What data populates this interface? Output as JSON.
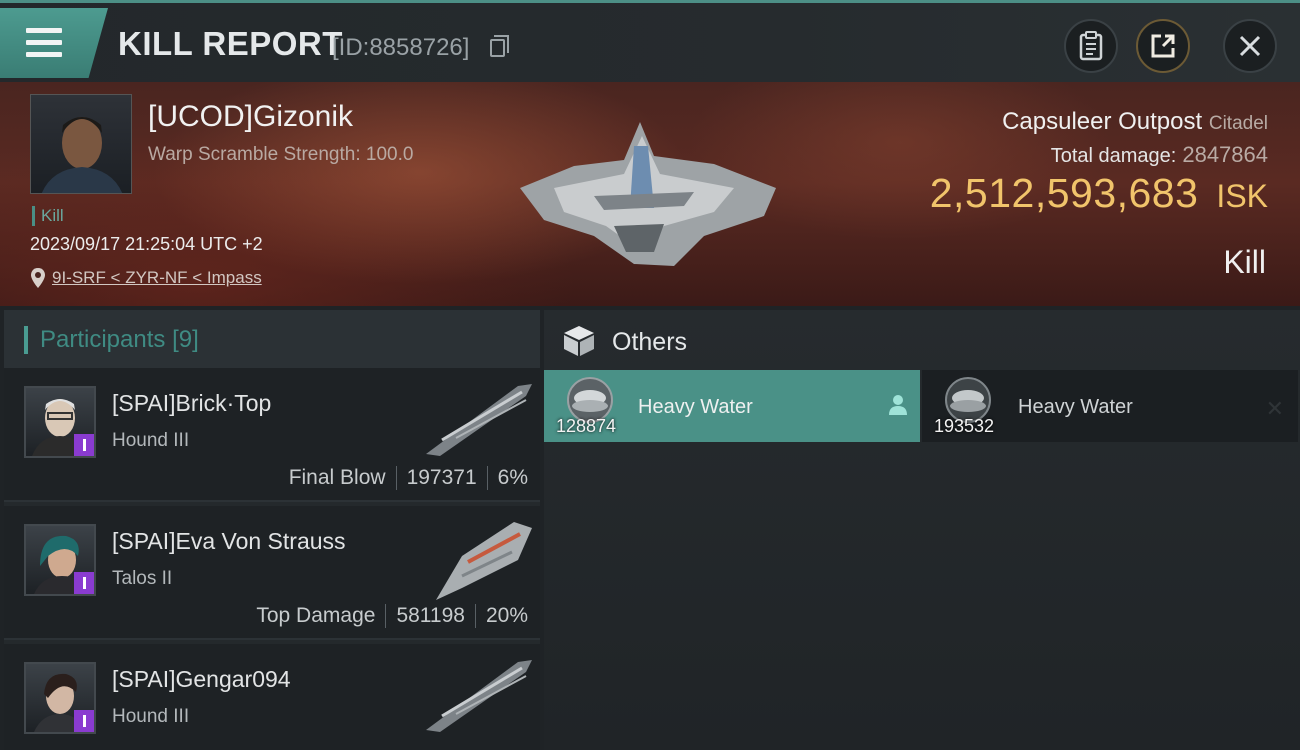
{
  "header": {
    "title": "KILL REPORT",
    "report_id": "[ID:8858726]"
  },
  "victim": {
    "name": "[UCOD]Gizonik",
    "subtitle": "Warp Scramble Strength: 100.0",
    "tag": "Kill",
    "time": "2023/09/17 21:25:04 UTC +2",
    "location": "9I-SRF < ZYR-NF < Impass",
    "target_type": "Capsuleer Outpost",
    "target_class": "Citadel",
    "total_damage_label": "Total damage:",
    "total_damage": "2847864",
    "isk_value": "2,512,593,683",
    "isk_unit": "ISK",
    "result": "Kill"
  },
  "participants": {
    "title": "Participants",
    "count": "[9]",
    "rows": [
      {
        "name": "[SPAI]Brick·Top",
        "ship": "Hound III",
        "role": "Final Blow",
        "damage": "197371",
        "percent": "6%"
      },
      {
        "name": "[SPAI]Eva Von Strauss",
        "ship": "Talos II",
        "role": "Top Damage",
        "damage": "581198",
        "percent": "20%"
      },
      {
        "name": "[SPAI]Gengar094",
        "ship": "Hound III",
        "role": "",
        "damage": "",
        "percent": ""
      }
    ]
  },
  "others": {
    "title": "Others",
    "items": [
      {
        "name": "Heavy Water",
        "qty": "128874"
      },
      {
        "name": "Heavy Water",
        "qty": "193532"
      }
    ]
  },
  "colors": {
    "accent": "#4a9187",
    "isk": "#f1c46b",
    "badge": "#8a3bd0"
  }
}
